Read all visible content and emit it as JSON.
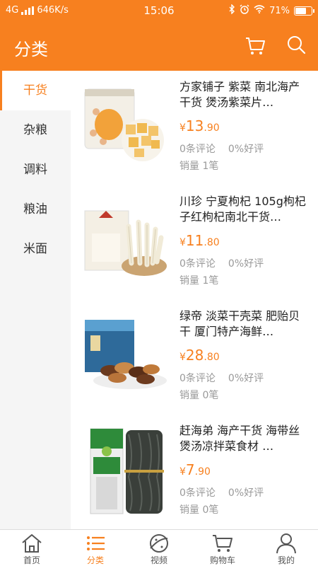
{
  "status_bar": {
    "network": "4G",
    "speed": "646K/s",
    "time": "15:06",
    "battery": "71%",
    "battery_level": 0.71
  },
  "header": {
    "title": "分类",
    "cart_icon": "shopping-cart-icon",
    "search_icon": "search-icon"
  },
  "sidebar": {
    "items": [
      {
        "label": "干货",
        "active": true
      },
      {
        "label": "杂粮",
        "active": false
      },
      {
        "label": "调料",
        "active": false
      },
      {
        "label": "粮油",
        "active": false
      },
      {
        "label": "米面",
        "active": false
      }
    ]
  },
  "products": [
    {
      "name": "方家铺子 紫菜 南北海产干货 煲汤紫菜片…",
      "currency": "¥",
      "price_int": "13",
      "price_dec": ".90",
      "reviews": "0条评论",
      "rating": "0%好评",
      "sales": "销量 1笔"
    },
    {
      "name": "川珍 宁夏枸杞 105g枸杞子红枸杞南北干货…",
      "currency": "¥",
      "price_int": "11",
      "price_dec": ".80",
      "reviews": "0条评论",
      "rating": "0%好评",
      "sales": "销量 1笔"
    },
    {
      "name": "绿帝 淡菜干壳菜 肥贻贝干 厦门特产海鲜…",
      "currency": "¥",
      "price_int": "28",
      "price_dec": ".80",
      "reviews": "0条评论",
      "rating": "0%好评",
      "sales": "销量 0笔"
    },
    {
      "name": "赶海弟 海产干货 海带丝 煲汤凉拌菜食材 …",
      "currency": "¥",
      "price_int": "7",
      "price_dec": ".90",
      "reviews": "0条评论",
      "rating": "0%好评",
      "sales": "销量 0笔"
    }
  ],
  "tabbar": {
    "items": [
      {
        "label": "首页",
        "icon": "home-icon",
        "active": false
      },
      {
        "label": "分类",
        "icon": "category-list-icon",
        "active": true
      },
      {
        "label": "视频",
        "icon": "video-planet-icon",
        "active": false
      },
      {
        "label": "购物车",
        "icon": "cart-icon",
        "active": false
      },
      {
        "label": "我的",
        "icon": "user-icon",
        "active": false
      }
    ]
  },
  "colors": {
    "accent": "#f7801f",
    "sidebar_bg": "#f5f5f5",
    "muted_text": "#999999"
  }
}
